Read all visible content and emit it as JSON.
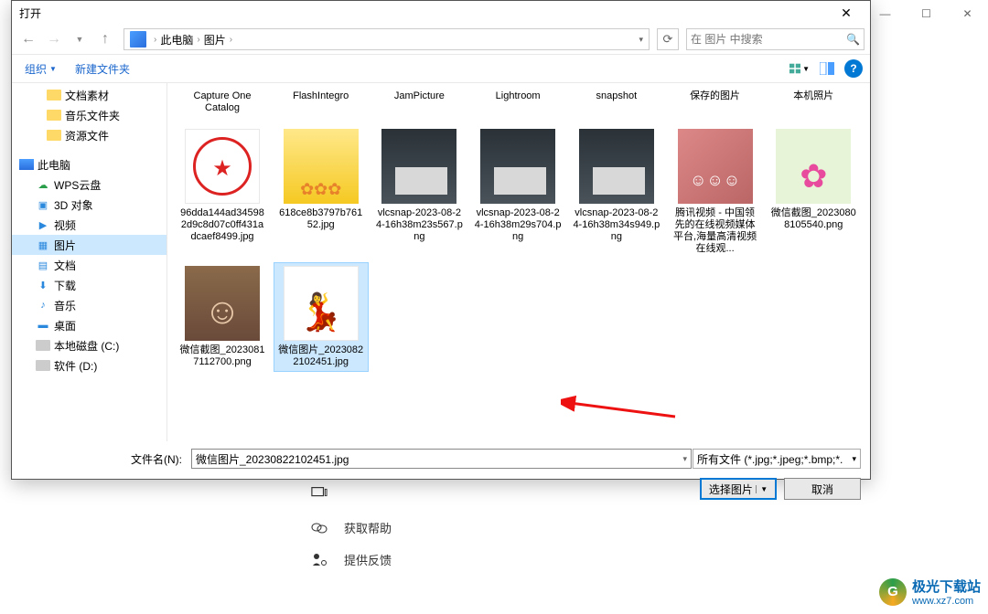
{
  "bg_window": {
    "buttons": [
      "—",
      "☐",
      "✕"
    ],
    "items": [
      {
        "icon": "chat",
        "label": "获取帮助"
      },
      {
        "icon": "feedback",
        "label": "提供反馈"
      }
    ]
  },
  "dialog": {
    "title": "打开",
    "breadcrumb": {
      "root": "此电脑",
      "folder": "图片"
    },
    "search_placeholder": "在 图片 中搜索",
    "toolbar": {
      "organize": "组织",
      "new_folder": "新建文件夹"
    },
    "sidebar": [
      {
        "label": "文档素材",
        "icon": "folder",
        "indent": 2
      },
      {
        "label": "音乐文件夹",
        "icon": "folder",
        "indent": 2
      },
      {
        "label": "资源文件",
        "icon": "folder",
        "indent": 2
      },
      {
        "label": "此电脑",
        "icon": "pc",
        "indent": 0
      },
      {
        "label": "WPS云盘",
        "icon": "cloud",
        "indent": 1
      },
      {
        "label": "3D 对象",
        "icon": "3d",
        "indent": 1
      },
      {
        "label": "视频",
        "icon": "video",
        "indent": 1
      },
      {
        "label": "图片",
        "icon": "pic",
        "indent": 1,
        "selected": true
      },
      {
        "label": "文档",
        "icon": "doc",
        "indent": 1
      },
      {
        "label": "下载",
        "icon": "dl",
        "indent": 1
      },
      {
        "label": "音乐",
        "icon": "music",
        "indent": 1
      },
      {
        "label": "桌面",
        "icon": "desk",
        "indent": 1
      },
      {
        "label": "本地磁盘 (C:)",
        "icon": "drive",
        "indent": 1
      },
      {
        "label": "软件 (D:)",
        "icon": "drive",
        "indent": 1
      }
    ],
    "folder_row": [
      "Capture One Catalog",
      "FlashIntegro",
      "JamPicture",
      "Lightroom",
      "snapshot",
      "保存的图片",
      "本机照片"
    ],
    "files": [
      {
        "name": "96dda144ad345982d9c8d07c0ff431adcaef8499.jpg",
        "thumb": "seal"
      },
      {
        "name": "618ce8b3797b76152.jpg",
        "thumb": "flowers"
      },
      {
        "name": "vlcsnap-2023-08-24-16h38m23s567.png",
        "thumb": "room"
      },
      {
        "name": "vlcsnap-2023-08-24-16h38m29s704.png",
        "thumb": "room"
      },
      {
        "name": "vlcsnap-2023-08-24-16h38m34s949.png",
        "thumb": "room"
      },
      {
        "name": "腾讯视频 - 中国领先的在线视频媒体平台,海量高清视频在线观...",
        "thumb": "people"
      },
      {
        "name": "微信截图_20230808105540.png",
        "thumb": "lotus"
      },
      {
        "name": "微信截图_20230817112700.png",
        "thumb": "portrait"
      },
      {
        "name": "微信图片_20230822102451.jpg",
        "thumb": "pose",
        "selected": true
      }
    ],
    "filename_label": "文件名(N):",
    "filename_value": "微信图片_20230822102451.jpg",
    "filetype": "所有文件 (*.jpg;*.jpeg;*.bmp;*.",
    "btn_open": "选择图片",
    "btn_cancel": "取消"
  },
  "watermark": {
    "name": "极光下载站",
    "url": "www.xz7.com"
  }
}
